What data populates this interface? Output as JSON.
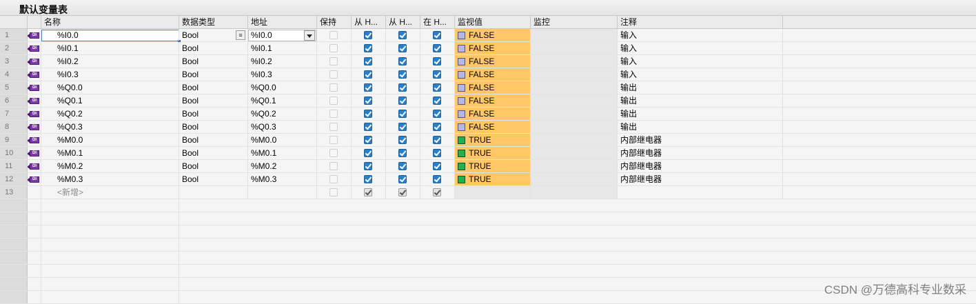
{
  "table_title": "默认变量表",
  "columns": {
    "name": "名称",
    "data_type": "数据类型",
    "address": "地址",
    "retain": "保持",
    "from_h1": "从 H...",
    "from_h2": "从 H...",
    "in_h": "在 H...",
    "monitor_value": "监视值",
    "monitor_control": "监控",
    "comment": "注释"
  },
  "rows": [
    {
      "num": "1",
      "name": "%I0.0",
      "type": "Bool",
      "address": "%I0.0",
      "retain": false,
      "h1": true,
      "h2": true,
      "h3": true,
      "value": "FALSE",
      "comment": "输入"
    },
    {
      "num": "2",
      "name": "%I0.1",
      "type": "Bool",
      "address": "%I0.1",
      "retain": false,
      "h1": true,
      "h2": true,
      "h3": true,
      "value": "FALSE",
      "comment": "输入"
    },
    {
      "num": "3",
      "name": "%I0.2",
      "type": "Bool",
      "address": "%I0.2",
      "retain": false,
      "h1": true,
      "h2": true,
      "h3": true,
      "value": "FALSE",
      "comment": "输入"
    },
    {
      "num": "4",
      "name": "%I0.3",
      "type": "Bool",
      "address": "%I0.3",
      "retain": false,
      "h1": true,
      "h2": true,
      "h3": true,
      "value": "FALSE",
      "comment": "输入"
    },
    {
      "num": "5",
      "name": "%Q0.0",
      "type": "Bool",
      "address": "%Q0.0",
      "retain": false,
      "h1": true,
      "h2": true,
      "h3": true,
      "value": "FALSE",
      "comment": "输出"
    },
    {
      "num": "6",
      "name": "%Q0.1",
      "type": "Bool",
      "address": "%Q0.1",
      "retain": false,
      "h1": true,
      "h2": true,
      "h3": true,
      "value": "FALSE",
      "comment": "输出"
    },
    {
      "num": "7",
      "name": "%Q0.2",
      "type": "Bool",
      "address": "%Q0.2",
      "retain": false,
      "h1": true,
      "h2": true,
      "h3": true,
      "value": "FALSE",
      "comment": "输出"
    },
    {
      "num": "8",
      "name": "%Q0.3",
      "type": "Bool",
      "address": "%Q0.3",
      "retain": false,
      "h1": true,
      "h2": true,
      "h3": true,
      "value": "FALSE",
      "comment": "输出"
    },
    {
      "num": "9",
      "name": "%M0.0",
      "type": "Bool",
      "address": "%M0.0",
      "retain": false,
      "h1": true,
      "h2": true,
      "h3": true,
      "value": "TRUE",
      "comment": "内部继电器"
    },
    {
      "num": "10",
      "name": "%M0.1",
      "type": "Bool",
      "address": "%M0.1",
      "retain": false,
      "h1": true,
      "h2": true,
      "h3": true,
      "value": "TRUE",
      "comment": "内部继电器"
    },
    {
      "num": "11",
      "name": "%M0.2",
      "type": "Bool",
      "address": "%M0.2",
      "retain": false,
      "h1": true,
      "h2": true,
      "h3": true,
      "value": "TRUE",
      "comment": "内部继电器"
    },
    {
      "num": "12",
      "name": "%M0.3",
      "type": "Bool",
      "address": "%M0.3",
      "retain": false,
      "h1": true,
      "h2": true,
      "h3": true,
      "value": "TRUE",
      "comment": "内部继电器"
    }
  ],
  "new_row": {
    "num": "13",
    "label": "<新增>"
  },
  "empty_rows": 8,
  "tag_icon": "bool-tag-icon",
  "tag_icon_text": "DI",
  "colors": {
    "monitor_highlight": "#ffc766",
    "checkbox_on": "#2a7fc8",
    "false_indicator": "#b6b6e4",
    "true_indicator": "#22b14c",
    "tag_icon": "#7b3aa8"
  },
  "watermark": "CSDN @万德高科专业数采"
}
